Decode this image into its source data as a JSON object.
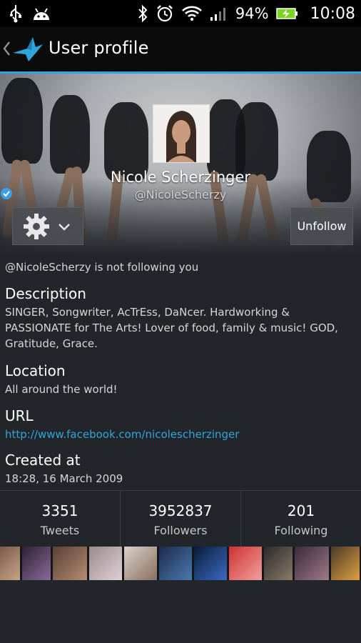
{
  "status_bar": {
    "battery": "94%",
    "time": "10:08"
  },
  "action_bar": {
    "title": "User profile"
  },
  "profile": {
    "name": "Nicole Scherzinger",
    "handle": "@NicoleScherzy",
    "unfollow_label": "Unfollow",
    "follow_status": "@NicoleScherzy is not following you"
  },
  "sections": {
    "description_label": "Description",
    "description_value": "SINGER, Songwriter, AcTrEss, DaNcer. Hardworking & PASSIONATE for The Arts! Lover of food, family & music! GOD, Gratitude, Grace.",
    "location_label": "Location",
    "location_value": "All around the world!",
    "url_label": "URL",
    "url_value": "http://www.facebook.com/nicolescherzinger",
    "created_label": "Created at",
    "created_value": "18:28, 16 March 2009"
  },
  "stats": [
    {
      "value": "3351",
      "label": "Tweets"
    },
    {
      "value": "3952837",
      "label": "Followers"
    },
    {
      "value": "201",
      "label": "Following"
    }
  ],
  "colors": {
    "accent": "#2ea6d9",
    "background": "#22252a"
  }
}
